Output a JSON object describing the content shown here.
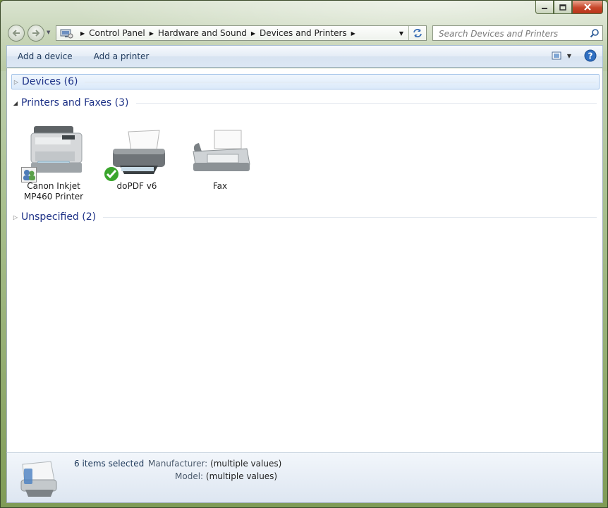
{
  "window": {
    "caption": {
      "minimize_icon": "minimize-icon",
      "maximize_icon": "maximize-icon",
      "close_icon": "close-icon"
    }
  },
  "nav": {
    "breadcrumb": [
      "Control Panel",
      "Hardware and Sound",
      "Devices and Printers"
    ],
    "search_placeholder": "Search Devices and Printers"
  },
  "toolbar": {
    "add_device": "Add a device",
    "add_printer": "Add a printer"
  },
  "groups": [
    {
      "title": "Devices (6)",
      "expanded": false
    },
    {
      "title": "Printers and Faxes (3)",
      "expanded": true
    },
    {
      "title": "Unspecified (2)",
      "expanded": false
    }
  ],
  "printers": [
    {
      "line1": "Canon Inkjet",
      "line2": "MP460 Printer",
      "badge": "shared-icon"
    },
    {
      "line1": "doPDF v6",
      "line2": "",
      "badge": "default-check-icon"
    },
    {
      "line1": "Fax",
      "line2": "",
      "badge": ""
    }
  ],
  "statusbar": {
    "count": "6 items selected",
    "manufacturer_label": "Manufacturer:",
    "manufacturer_value": "(multiple values)",
    "model_label": "Model:",
    "model_value": "(multiple values)"
  },
  "colors": {
    "link_blue": "#1e3287",
    "toolbar_text": "#1e395b",
    "check_green": "#3aa52c"
  }
}
